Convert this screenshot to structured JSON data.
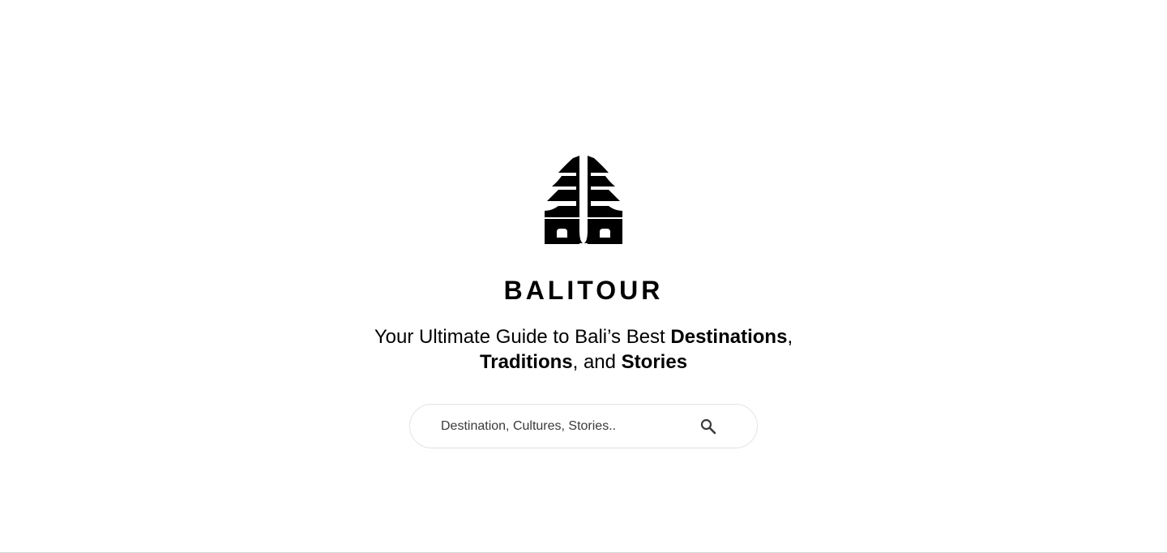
{
  "brand": {
    "logo_icon": "bali-temple-icon",
    "name": "BALITOUR"
  },
  "tagline": {
    "part1": "Your Ultimate Guide to Bali’s Best ",
    "destinations": "Destinations",
    "comma1": ",",
    "traditions": "Traditions",
    "part2": ", and ",
    "stories": "Stories"
  },
  "search": {
    "placeholder": "Destination, Cultures, Stories..",
    "value": "",
    "icon": "search-icon"
  },
  "colors": {
    "text": "#000000",
    "background": "#ffffff",
    "search_border": "#e3e3e3"
  }
}
